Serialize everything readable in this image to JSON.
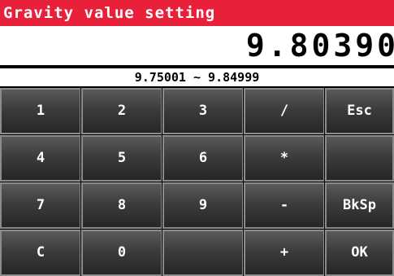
{
  "title": "Gravity value setting",
  "display": {
    "value": "9.80390"
  },
  "range_text": "9.75001 ~ 9.84999",
  "colors": {
    "title_bar": "#e8203a",
    "key_face": "#3c3c3c",
    "display_bg": "#ffffff"
  },
  "keys": [
    {
      "label": "1"
    },
    {
      "label": "2"
    },
    {
      "label": "3"
    },
    {
      "label": "/"
    },
    {
      "label": "Esc"
    },
    {
      "label": "4"
    },
    {
      "label": "5"
    },
    {
      "label": "6"
    },
    {
      "label": "*"
    },
    {
      "label": ""
    },
    {
      "label": "7"
    },
    {
      "label": "8"
    },
    {
      "label": "9"
    },
    {
      "label": "-"
    },
    {
      "label": "BkSp"
    },
    {
      "label": "C"
    },
    {
      "label": "0"
    },
    {
      "label": ""
    },
    {
      "label": "+"
    },
    {
      "label": "OK"
    }
  ]
}
